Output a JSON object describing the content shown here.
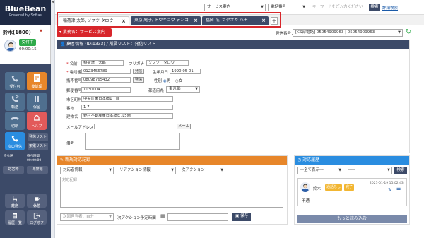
{
  "app": {
    "logo_title": "BlueBean",
    "logo_sub": "Powered by Softas"
  },
  "agent": {
    "name": "鈴木(1800)",
    "status": "受付中",
    "timer": "00:00:15"
  },
  "sidebar": {
    "tiles": [
      {
        "label": "受付可",
        "color": "#4f6f8f"
      },
      {
        "label": "後処理",
        "color": "#e7862a"
      },
      {
        "label": "転送",
        "color": "#4f6f8f"
      },
      {
        "label": "保留",
        "color": "#4f6f8f"
      },
      {
        "label": "切断",
        "color": "#4f6f8f"
      },
      {
        "label": "ヘルプ",
        "color": "#e25a5a"
      },
      {
        "label": "次の発信",
        "color": "#2a8de0"
      },
      {
        "label": "発信リスト",
        "color": "#55617d"
      },
      {
        "label": "架電リスト",
        "color": "#55617d"
      }
    ],
    "stats": [
      {
        "label": "待ち呼",
        "value": ""
      },
      {
        "label": "待ち時間",
        "value": "00:00:00"
      }
    ],
    "buttons": [
      "応答時",
      "再架電"
    ],
    "bottom_tiles": [
      "離席",
      "休憩",
      "履歴一覧",
      "ログオフ"
    ]
  },
  "topbar": {
    "service_select": "サービス案内",
    "phone_select": "電話番号",
    "keyword_placeholder": "キーワードをご入力ください",
    "search_label": "検索",
    "advanced_label": "詳細検索"
  },
  "tabs": [
    {
      "label": "稲荷津 太郎, ソフツ タロウ"
    },
    {
      "label": "東京 庵子, トウキョウ デンコ"
    },
    {
      "label": "福岡 花, フクオカ ハナ"
    }
  ],
  "work": {
    "header": "業務名：サービス案内",
    "outbound_label": "発信番号：",
    "outbound_value": "[CS部電話] 05054909963 | 05054909963"
  },
  "customer": {
    "header": "顧客情報 (ID:1333) / 所属リスト：発信リスト",
    "labels": {
      "name": "名前",
      "kana": "フリガナ",
      "phone": "電話番号",
      "birthday": "生年月日",
      "mobile": "携帯番号",
      "gender": "性別",
      "zip": "郵便番号",
      "pref": "都道府県",
      "city": "市区町村",
      "addr": "番地",
      "building": "建物名",
      "email": "メールアドレス",
      "note": "備考"
    },
    "values": {
      "name": "稲荷津　太郎",
      "kana": "ソフツ　タロウ",
      "phone": "0123456789",
      "birthday": "1990-05-01",
      "mobile": "08098765432",
      "gender_male": "男",
      "gender_female": "女",
      "zip": "1030004",
      "pref": "東京都",
      "city": "中央区東日本橋1丁目",
      "addr": "1-7",
      "building": "野村不動産東日本橋ビル5階",
      "email": "",
      "note": ""
    },
    "call_label": "発信",
    "mail_label": "メール"
  },
  "newlog": {
    "header": "新規対応記録",
    "select1": "対応者情報",
    "select2": "リアクション情報",
    "select3": "次アクション",
    "textarea_placeholder": "対応記録",
    "assignee": "次回担当者：自分",
    "next_label": "次アクション予定時間",
    "save_label": "保存"
  },
  "history": {
    "header": "対応履歴",
    "filter1": "---全て表示---",
    "filter2": "-----",
    "search_label": "検索",
    "entry": {
      "name": "鈴木",
      "tag1": "通話なし",
      "tag2": "完了",
      "date": "2021-01-19 15:02:43",
      "status": "不通"
    },
    "more_label": "もっと読み込む"
  }
}
